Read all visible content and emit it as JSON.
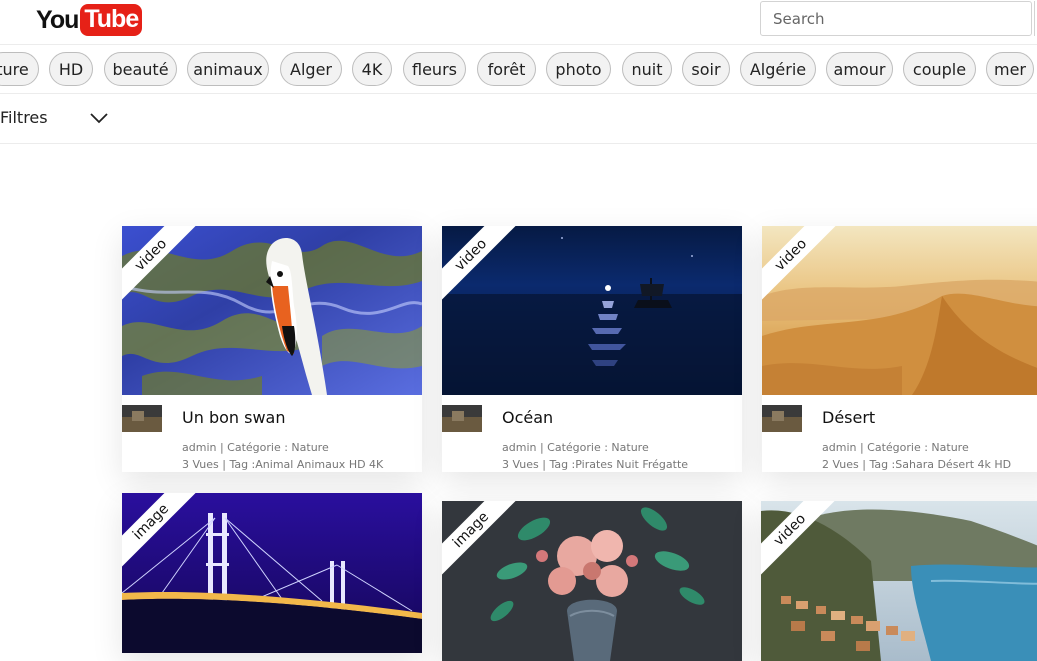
{
  "header": {
    "logo_you": "You",
    "logo_tube": "Tube",
    "search_placeholder": "Search"
  },
  "tags": [
    "ture",
    "HD",
    "beauté",
    "animaux",
    "Alger",
    "4K",
    "fleurs",
    "forêt",
    "photo",
    "nuit",
    "soir",
    "Algérie",
    "amour",
    "couple",
    "mer"
  ],
  "filters": {
    "label": "Filtres"
  },
  "cards": [
    {
      "type": "video",
      "title": "Un bon swan",
      "meta1": "admin | Catégorie : Nature",
      "meta2": "3 Vues | Tag :Animal Animaux HD 4K"
    },
    {
      "type": "video",
      "title": "Océan",
      "meta1": "admin | Catégorie : Nature",
      "meta2": "3 Vues | Tag :Pirates Nuit Frégatte"
    },
    {
      "type": "video",
      "title": "Désert",
      "meta1": "admin | Catégorie : Nature",
      "meta2": "2 Vues | Tag :Sahara Désert 4k HD"
    },
    {
      "type": "image"
    },
    {
      "type": "image"
    },
    {
      "type": "video"
    }
  ],
  "colors": {
    "brand_red": "#e62117",
    "chip_bg": "#f2f2f2",
    "chip_border": "#bdbdbd"
  }
}
